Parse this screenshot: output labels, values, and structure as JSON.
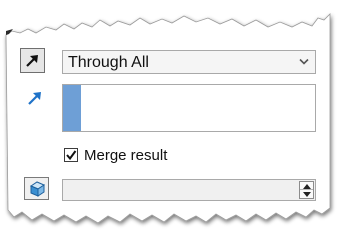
{
  "feature": {
    "end_condition": {
      "selected": "Through All",
      "reverse_icon": "reverse-direction-arrow-icon",
      "dropdown_icon": "chevron-down-icon"
    },
    "direction": {
      "icon": "direction-arrow-icon",
      "selection_value": ""
    },
    "merge_result": {
      "label": "Merge result",
      "checked": true
    },
    "feature_scope": {
      "icon": "solid-body-icon",
      "value": ""
    }
  },
  "colors": {
    "selection_accent": "#6e9fd6",
    "arrow_blue": "#1f73c8",
    "field_border": "#a9a9a9"
  }
}
